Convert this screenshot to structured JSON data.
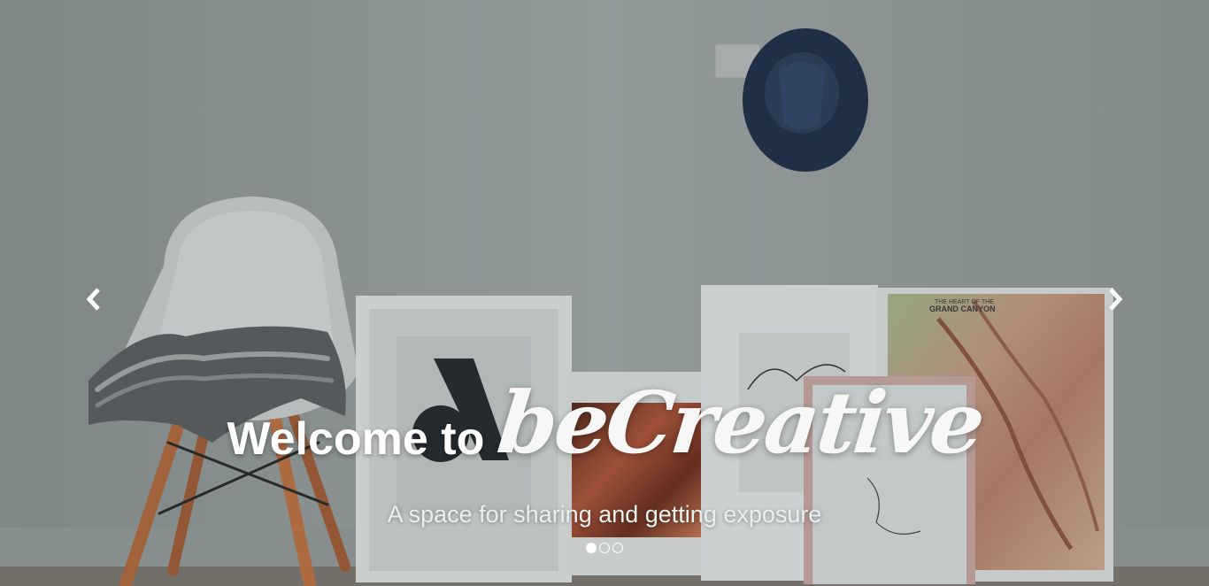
{
  "hero": {
    "welcome": "Welcome to",
    "brand": "beCreative",
    "subtitle": "A space for sharing and getting exposure"
  },
  "carousel": {
    "prev_icon": "chevron-left-icon",
    "next_icon": "chevron-right-icon",
    "slide_count": 3,
    "active_slide": 1
  },
  "background": {
    "poster_text_line1": "THE HEART OF THE",
    "poster_text_line2": "GRAND CANYON"
  },
  "colors": {
    "wall": "#9ba3a2",
    "text": "#ffffff",
    "subtitle": "#e7f1ef",
    "hat": "#2b3a52"
  }
}
